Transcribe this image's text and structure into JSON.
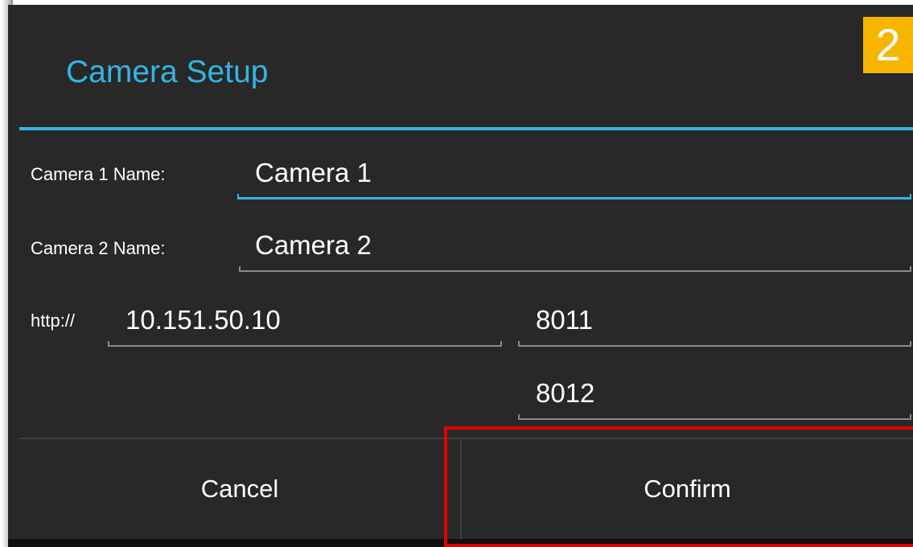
{
  "dialog": {
    "title": "Camera Setup",
    "step_badge": "2"
  },
  "form": {
    "camera1": {
      "label": "Camera 1 Name:",
      "value": "Camera 1",
      "focused": true
    },
    "camera2": {
      "label": "Camera 2 Name:",
      "value": "Camera 2"
    },
    "protocol_label": "http://",
    "host": {
      "value": "10.151.50.10"
    },
    "port1": {
      "value": "8011"
    },
    "port2": {
      "value": "8012"
    }
  },
  "buttons": {
    "cancel_label": "Cancel",
    "confirm_label": "Confirm"
  },
  "colors": {
    "accent": "#33b5e5",
    "background": "#282828",
    "badge": "#f7b500",
    "highlight": "#e30000"
  }
}
